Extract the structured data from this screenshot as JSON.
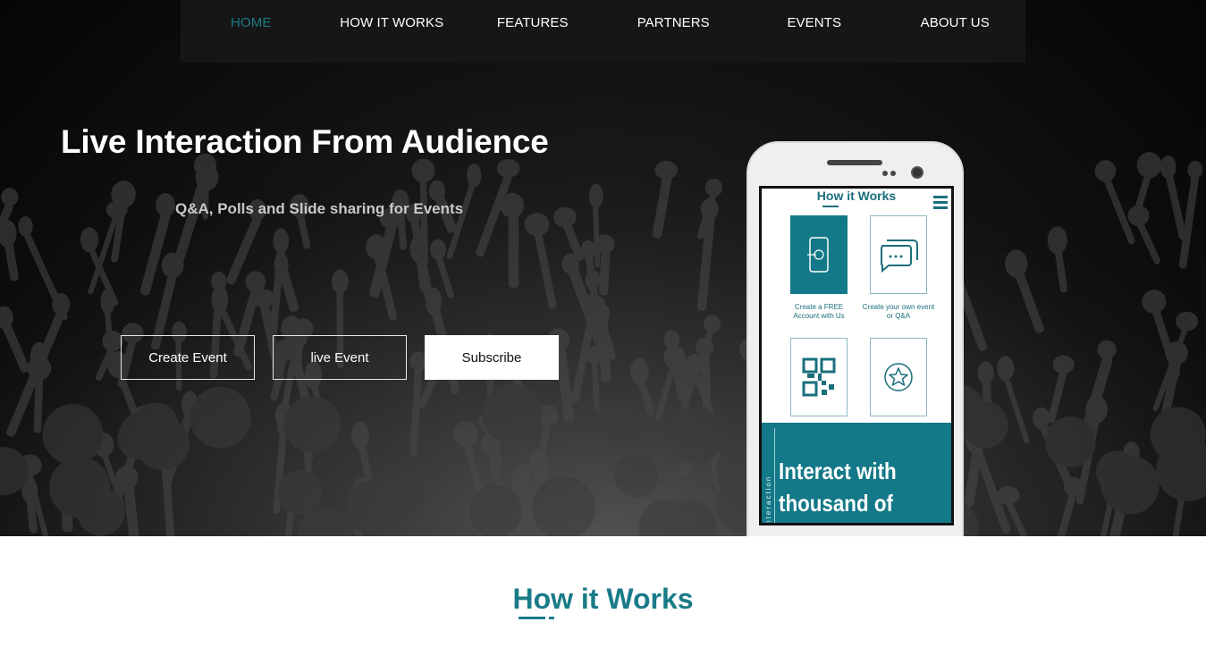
{
  "nav": {
    "items": [
      {
        "label": "HOME",
        "active": true
      },
      {
        "label": "HOW IT WORKS",
        "active": false
      },
      {
        "label": "FEATURES",
        "active": false
      },
      {
        "label": "PARTNERS",
        "active": false
      },
      {
        "label": "EVENTS",
        "active": false
      },
      {
        "label": "ABOUT US",
        "active": false
      }
    ]
  },
  "hero": {
    "title": "Live Interaction From Audience",
    "subtitle": "Q&A, Polls and Slide sharing for Events",
    "buttons": {
      "create_event": "Create Event",
      "live_event": "live Event",
      "subscribe": "Subscribe"
    }
  },
  "phone_screen": {
    "title": "How it Works",
    "tiles": [
      {
        "caption": "Create a FREE Account with Us",
        "icon": "smartphone-icon"
      },
      {
        "caption": "Create your own event or Q&A",
        "icon": "chat-bubbles-icon"
      },
      {
        "caption": "",
        "icon": "qr-code-icon"
      },
      {
        "caption": "",
        "icon": "star-icon"
      }
    ],
    "band_side_text": "Interaction",
    "band_line1": "Interact with",
    "band_line2": "thousand of"
  },
  "section": {
    "title": "How it Works"
  },
  "colors": {
    "accent": "#1a7b88",
    "nav_bg": "#161616"
  }
}
